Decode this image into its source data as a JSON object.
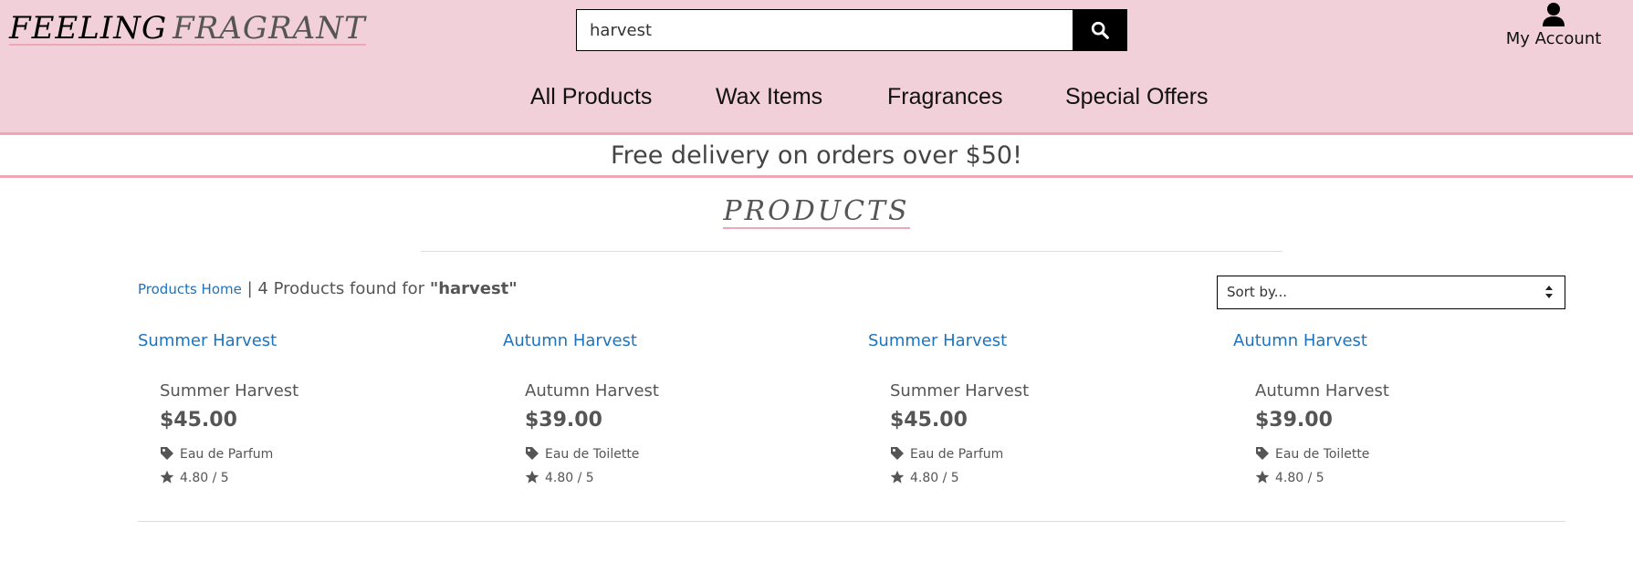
{
  "header": {
    "logo_part1": "FEELING",
    "logo_part2": "FRAGRANT",
    "search": {
      "value": "harvest",
      "icon": "search-icon"
    },
    "account": {
      "label": "My Account",
      "icon": "user-icon"
    }
  },
  "nav": {
    "items": [
      {
        "label": "All Products"
      },
      {
        "label": "Wax Items"
      },
      {
        "label": "Fragrances"
      },
      {
        "label": "Special Offers"
      }
    ]
  },
  "promo": {
    "text": "Free delivery on orders over $50!"
  },
  "page": {
    "title": "PRODUCTS"
  },
  "results": {
    "home_link": "Products Home",
    "separator": "|",
    "count_text": "4 Products found for",
    "query": "\"harvest\"",
    "sort_placeholder": "Sort by..."
  },
  "products": [
    {
      "image_alt": "Summer Harvest",
      "name": "Summer Harvest",
      "price": "$45.00",
      "type": "Eau de Parfum",
      "rating": "4.80 / 5"
    },
    {
      "image_alt": "Autumn Harvest",
      "name": "Autumn Harvest",
      "price": "$39.00",
      "type": "Eau de Toilette",
      "rating": "4.80 / 5"
    },
    {
      "image_alt": "Summer Harvest",
      "name": "Summer Harvest",
      "price": "$45.00",
      "type": "Eau de Parfum",
      "rating": "4.80 / 5"
    },
    {
      "image_alt": "Autumn Harvest",
      "name": "Autumn Harvest",
      "price": "$39.00",
      "type": "Eau de Toilette",
      "rating": "4.80 / 5"
    }
  ],
  "colors": {
    "header_bg": "#f1d0da",
    "accent_pink": "#eea7b5",
    "link_blue": "#1e73be",
    "text_gray": "#555555"
  }
}
